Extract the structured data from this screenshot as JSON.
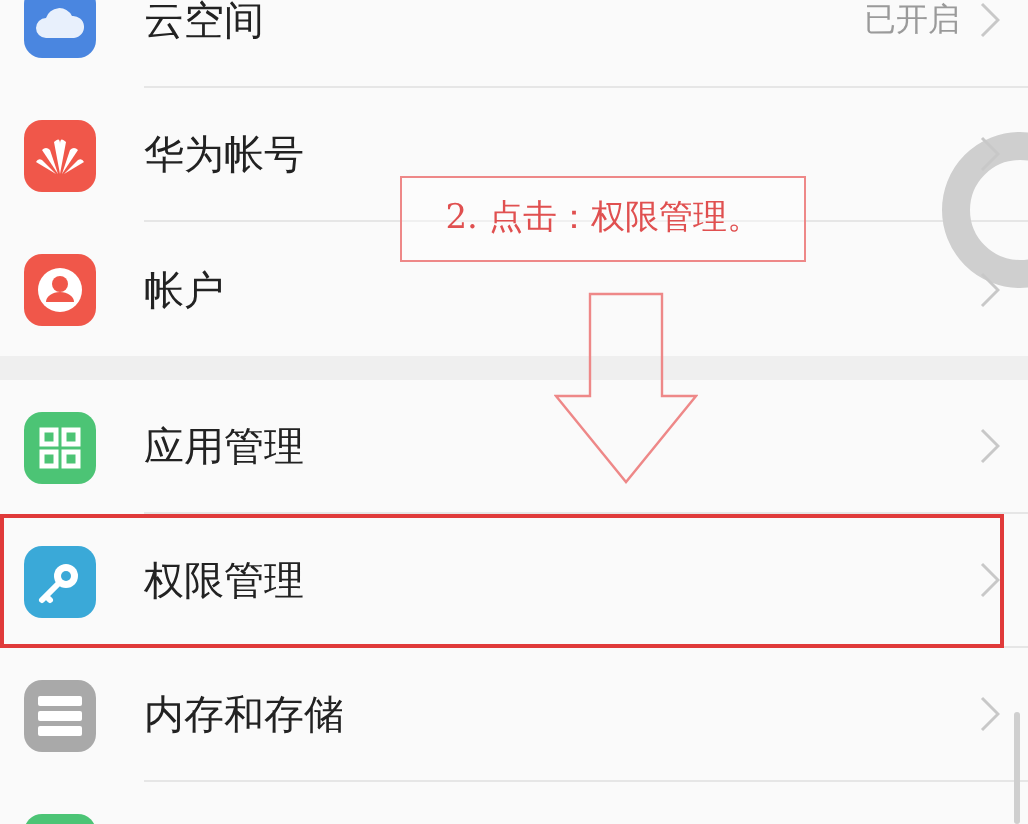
{
  "sections": [
    {
      "items": [
        {
          "kind": "cloud",
          "label": "云空间",
          "value": "已开启",
          "highlighted": false
        },
        {
          "kind": "huawei",
          "label": "华为帐号",
          "highlighted": false
        },
        {
          "kind": "user",
          "label": "帐户",
          "highlighted": false
        }
      ]
    },
    {
      "items": [
        {
          "kind": "apps",
          "label": "应用管理",
          "highlighted": false
        },
        {
          "kind": "key",
          "label": "权限管理",
          "highlighted": true
        },
        {
          "kind": "storage",
          "label": "内存和存储",
          "highlighted": false
        },
        {
          "kind": "green",
          "highlighted": false
        }
      ]
    }
  ],
  "annotation": {
    "text": "2. 点击：权限管理。"
  }
}
